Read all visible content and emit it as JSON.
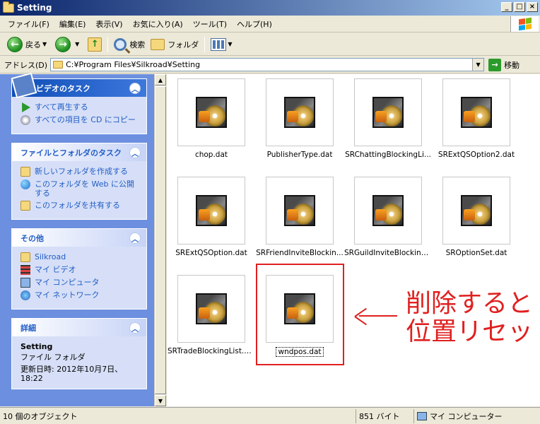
{
  "window": {
    "title": "Setting"
  },
  "menu": [
    "ファイル(F)",
    "編集(E)",
    "表示(V)",
    "お気に入り(A)",
    "ツール(T)",
    "ヘルプ(H)"
  ],
  "toolbar": {
    "back": "戻る",
    "search": "検索",
    "folders": "フォルダ"
  },
  "address": {
    "label": "アドレス(D)",
    "path": "C:¥Program Files¥Silkroad¥Setting",
    "go": "移動"
  },
  "panels": {
    "video": {
      "title": "ビデオのタスク",
      "items": [
        "すべて再生する",
        "すべての項目を CD にコピー"
      ]
    },
    "filetasks": {
      "title": "ファイルとフォルダのタスク",
      "items": [
        "新しいフォルダを作成する",
        "このフォルダを Web に公開する",
        "このフォルダを共有する"
      ]
    },
    "other": {
      "title": "その他",
      "items": [
        "Silkroad",
        "マイ ビデオ",
        "マイ コンピュータ",
        "マイ ネットワーク"
      ]
    },
    "details": {
      "title": "詳細",
      "name": "Setting",
      "type": "ファイル フォルダ",
      "modified": "更新日時: 2012年10月7日、18:22"
    }
  },
  "files": [
    "chop.dat",
    "PublisherType.dat",
    "SRChattingBlockingLi...",
    "SRExtQSOption2.dat",
    "SRExtQSOption.dat",
    "SRFriendInviteBlockin...",
    "SRGuildInviteBlocking...",
    "SROptionSet.dat",
    "SRTradeBlockingList.d...",
    "wndpos.dat"
  ],
  "annotation": {
    "line1": "削除すると",
    "line2": "位置リセット"
  },
  "status": {
    "count": "10 個のオブジェクト",
    "size": "851 バイト",
    "location": "マイ コンピューター"
  }
}
